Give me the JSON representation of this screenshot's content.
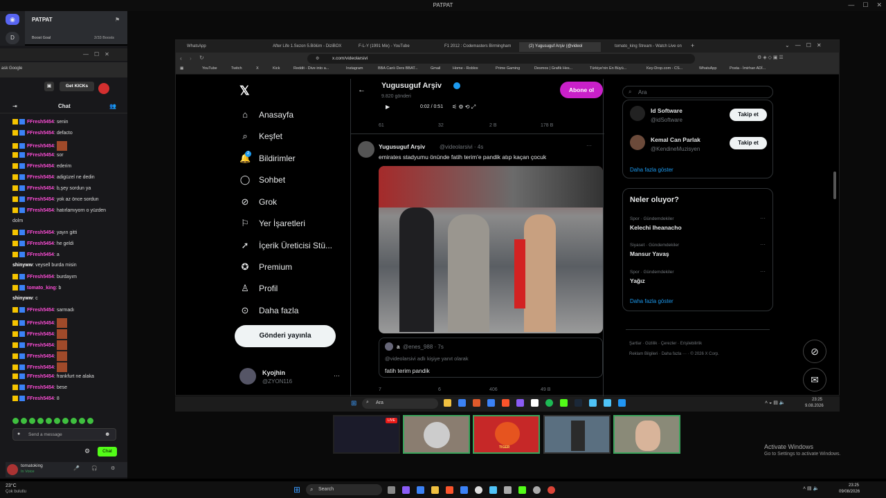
{
  "window": {
    "title": "PATPAT"
  },
  "discord": {
    "server_name": "PATPAT",
    "server_initial": "D",
    "boost_goal": "Boost Goal",
    "boosts": "2/33 Boosts",
    "search_label": "ask Google"
  },
  "chat": {
    "title": "Chat",
    "get_kicks": "Get KICKs",
    "send_placeholder": "Send a message",
    "send_button": "Chat",
    "messages": [
      {
        "user": "FFresh5454",
        "text": "senin"
      },
      {
        "user": "FFresh5454",
        "text": "defacto"
      },
      {
        "user": "FFresh5454",
        "text": ""
      },
      {
        "user": "FFresh5454",
        "text": "sor"
      },
      {
        "user": "FFresh5454",
        "text": "ederim"
      },
      {
        "user": "FFresh5454",
        "text": "adigüzel ne dedin"
      },
      {
        "user": "FFresh5454",
        "text": "b,şey sordun ya"
      },
      {
        "user": "FFresh5454",
        "text": "yok az önce sordun"
      },
      {
        "user": "FFresh5454",
        "text": "hatırlamıyorn o yüzden"
      },
      {
        "user": "",
        "text": "dolm"
      },
      {
        "user": "FFresh5454",
        "text": "yayın gitti"
      },
      {
        "user": "FFresh5454",
        "text": "he geldi"
      },
      {
        "user": "FFresh5454",
        "text": "a"
      },
      {
        "user": "shinyww",
        "text": "veysell burda misin"
      },
      {
        "user": "FFresh5454",
        "text": "burdayım"
      },
      {
        "user": "tomato_king",
        "text": "b"
      },
      {
        "user": "shinyww",
        "text": "c"
      },
      {
        "user": "FFresh5454",
        "text": "sarmadı"
      },
      {
        "user": "FFresh5454",
        "text": ""
      },
      {
        "user": "FFresh5454",
        "text": ""
      },
      {
        "user": "FFresh5454",
        "text": ""
      },
      {
        "user": "FFresh5454",
        "text": ""
      },
      {
        "user": "FFresh5454",
        "text": ""
      },
      {
        "user": "FFresh5454",
        "text": "frankfurt ne alaka"
      },
      {
        "user": "FFresh5454",
        "text": "bese"
      },
      {
        "user": "FFresh5454",
        "text": "8"
      }
    ]
  },
  "voice": {
    "user": "tomatoking",
    "status": "In Voice"
  },
  "weather": {
    "temp": "23°C",
    "desc": "Çok bulutlu"
  },
  "browser": {
    "tabs": [
      "WhatsApp",
      "After Life 1.Sezon 5.Bölüm - DiziBOX",
      "F-L-Y (1991 Mix) - YouTube",
      "F1 2012 : Codemasters Birmingham",
      "(2) Yugusuguf Arşiv (@videol",
      "tomato_king Stream - Watch Live on"
    ],
    "url": "x.com/videolarsivi",
    "bookmarks": [
      "YouTube",
      "Twitch",
      "X",
      "Kick",
      "Reddit - Dive into a...",
      "Instagram",
      "BBA Canlı Ders BBAT...",
      "Gmail",
      "Home - Roblox",
      "Prime Gaming",
      "Desmos | Grafik Hes...",
      "Türkiye'nin En Büyü...",
      "Key-Drop.com - CS...",
      "WhatsApp",
      "Posta - İmirhan ADİ..."
    ]
  },
  "x": {
    "nav": [
      "Anasayfa",
      "Keşfet",
      "Bildirimler",
      "Sohbet",
      "Grok",
      "Yer İşaretleri",
      "İçerik Üreticisi Stü...",
      "Premium",
      "Profil",
      "Daha fazla"
    ],
    "notif_badge": "2",
    "post_button": "Gönderi yayınla",
    "account": {
      "name": "Kyojhin",
      "handle": "@ZYON116"
    },
    "profile": {
      "name": "Yugusuguf Arşiv",
      "posts": "9.820 gönderi",
      "subscribe": "Abone ol"
    },
    "video": {
      "time": "0:02 / 0:51"
    },
    "prev_stats": {
      "replies": "61",
      "reposts": "32",
      "likes": "2 B",
      "views": "178 B"
    },
    "tweet": {
      "name": "Yugusuguf Arşiv",
      "handle": "@videolarsivi · 4s",
      "text": "emirates stadyumu önünde fatih terim'e pandik atıp kaçan çocuk",
      "stats": {
        "replies": "7",
        "reposts": "6",
        "likes": "406",
        "views": "49 B"
      }
    },
    "reply": {
      "name": "a",
      "handle": "@enes_988 · 7s",
      "context": "@videolarsivi adlı kişiye yanıt olarak",
      "text": "fatih terim pandik"
    },
    "search_placeholder": "Ara",
    "who_to_follow": [
      {
        "name": "Id Software",
        "handle": "@idSoftware"
      },
      {
        "name": "Kemal Can Parlak",
        "handle": "@KendineMuzisyen"
      }
    ],
    "follow_label": "Takip et",
    "show_more": "Daha fazla göster",
    "trends_title": "Neler oluyor?",
    "trends": [
      {
        "category": "Spor · Gündemdekiler",
        "name": "Kelechi Iheanacho"
      },
      {
        "category": "Siyaset · Gündemdekiler",
        "name": "Mansur Yavaş"
      },
      {
        "category": "Spor · Gündemdekiler",
        "name": "Yağız"
      }
    ],
    "footer": [
      "Şartlar",
      "Gizlilik",
      "Çerezler",
      "Erişilebilirlik",
      "Reklam Bilgileri",
      "Daha fazla ···",
      "© 2026 X Corp."
    ]
  },
  "inner_taskbar": {
    "search": "Ara",
    "time": "23:25",
    "date": "9.08.2026"
  },
  "activate": {
    "title": "Activate Windows",
    "sub": "Go to Settings to activate Windows."
  },
  "taskbar": {
    "search": "Search",
    "time": "23:25",
    "date": "09/08/2026"
  },
  "thumb_live": "LIVE",
  "tiger_label": "TIGER"
}
